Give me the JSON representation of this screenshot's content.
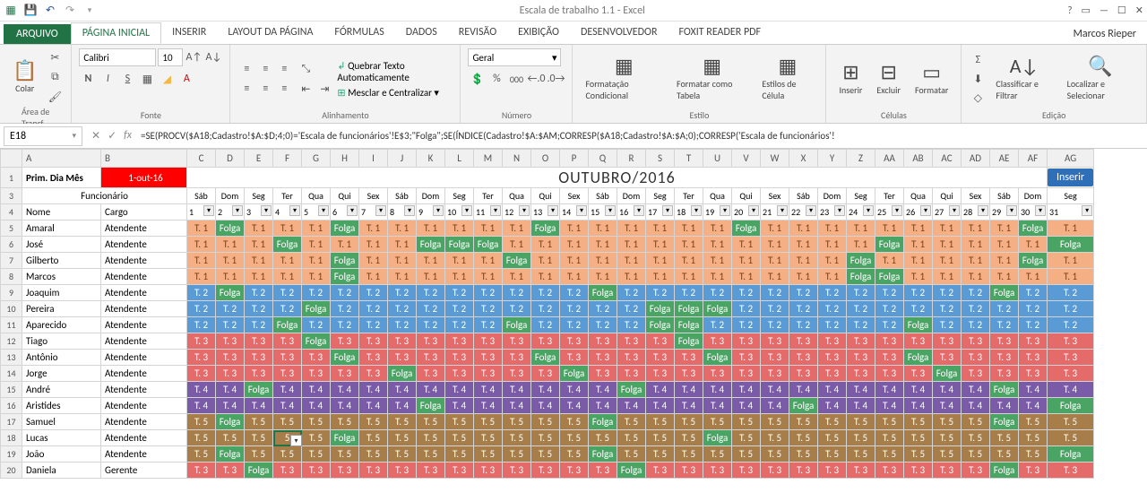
{
  "titlebar": {
    "title": "Escala de trabalho 1.1 - Excel"
  },
  "user": "Marcos Rieper",
  "tabs": {
    "file": "ARQUIVO",
    "items": [
      "PÁGINA INICIAL",
      "INSERIR",
      "LAYOUT DA PÁGINA",
      "FÓRMULAS",
      "DADOS",
      "REVISÃO",
      "EXIBIÇÃO",
      "DESENVOLVEDOR",
      "FOXIT READER PDF"
    ],
    "active": 0
  },
  "ribbon": {
    "clipboard": {
      "paste": "Colar",
      "label": "Área de Transf..."
    },
    "font": {
      "family": "Calibri",
      "size": "10",
      "label": "Fonte"
    },
    "align": {
      "wrap": "Quebrar Texto Automaticamente",
      "merge": "Mesclar e Centralizar",
      "label": "Alinhamento"
    },
    "number": {
      "format": "Geral",
      "label": "Número"
    },
    "styles": {
      "cond": "Formatação Condicional",
      "table": "Formatar como Tabela",
      "cell": "Estilos de Célula",
      "label": "Estilo"
    },
    "cells": {
      "insert": "Inserir",
      "delete": "Excluir",
      "format": "Formatar",
      "label": "Células"
    },
    "editing": {
      "sort": "Classificar e Filtrar",
      "find": "Localizar e Selecionar",
      "label": "Edição"
    }
  },
  "namebox": "E18",
  "formula": "=SE(PROCV($A18;Cadastro!$A:$D;4;0)='Escala de funcionários'!E$3;\"Folga\";SE(ÍNDICE(Cadastro!$A:$AM;CORRESP($A18;Cadastro!$A:$A;0);CORRESP('Escala de funcionários'!",
  "columns": [
    "",
    "A",
    "B",
    "C",
    "D",
    "E",
    "F",
    "G",
    "H",
    "I",
    "J",
    "K",
    "L",
    "M",
    "N",
    "O",
    "P",
    "Q",
    "R",
    "S",
    "T",
    "U",
    "V",
    "W",
    "X",
    "Y",
    "Z",
    "AA",
    "AB",
    "AC",
    "AD",
    "AE",
    "AF",
    "AG"
  ],
  "a1": "Prim. Dia Mês",
  "b1": "1-out-16",
  "month": "OUTUBRO/2016",
  "inserir": "Inserir",
  "funcHeader": "Funcionário",
  "nome": "Nome",
  "cargo": "Cargo",
  "dow": [
    "Sáb",
    "Dom",
    "Seg",
    "Ter",
    "Qua",
    "Qui",
    "Sex",
    "Sáb",
    "Dom",
    "Seg",
    "Ter",
    "Qua",
    "Qui",
    "Sex",
    "Sáb",
    "Dom",
    "Seg",
    "Ter",
    "Qua",
    "Qui",
    "Sex",
    "Sáb",
    "Dom",
    "Seg",
    "Ter",
    "Qua",
    "Qui",
    "Sex",
    "Sáb",
    "Dom",
    "Seg"
  ],
  "days": [
    "1",
    "2",
    "3",
    "4",
    "5",
    "6",
    "7",
    "8",
    "9",
    "10",
    "11",
    "12",
    "13",
    "14",
    "15",
    "16",
    "17",
    "18",
    "19",
    "20",
    "21",
    "22",
    "23",
    "24",
    "25",
    "26",
    "27",
    "28",
    "29",
    "30",
    "31"
  ],
  "rows": [
    {
      "n": "Amaral",
      "c": "Atendente",
      "s": [
        "T. 1",
        "Folga",
        "T. 1",
        "T. 1",
        "T. 1",
        "Folga",
        "T. 1",
        "T. 1",
        "T. 1",
        "T. 1",
        "T. 1",
        "T. 1",
        "Folga",
        "T. 1",
        "T. 1",
        "T. 1",
        "T. 1",
        "T. 1",
        "T. 1",
        "Folga",
        "T. 1",
        "T. 1",
        "T. 1",
        "T. 1",
        "T. 1",
        "T. 1",
        "T. 1",
        "T. 1",
        "T. 1",
        "Folga",
        "T. 1"
      ]
    },
    {
      "n": "José",
      "c": "Atendente",
      "s": [
        "T. 1",
        "T. 1",
        "T. 1",
        "Folga",
        "T. 1",
        "T. 1",
        "T. 1",
        "T. 1",
        "Folga",
        "Folga",
        "Folga",
        "T. 1",
        "T. 1",
        "T. 1",
        "T. 1",
        "T. 1",
        "T. 1",
        "T. 1",
        "T. 1",
        "T. 1",
        "T. 1",
        "T. 1",
        "T. 1",
        "T. 1",
        "Folga",
        "T. 1",
        "T. 1",
        "T. 1",
        "T. 1",
        "T. 1",
        "Folga"
      ]
    },
    {
      "n": "Gilberto",
      "c": "Atendente",
      "s": [
        "T. 1",
        "T. 1",
        "T. 1",
        "T. 1",
        "T. 1",
        "Folga",
        "T. 1",
        "T. 1",
        "T. 1",
        "T. 1",
        "T. 1",
        "Folga",
        "T. 1",
        "T. 1",
        "T. 1",
        "T. 1",
        "T. 1",
        "T. 1",
        "T. 1",
        "T. 1",
        "T. 1",
        "T. 1",
        "T. 1",
        "Folga",
        "T. 1",
        "T. 1",
        "T. 1",
        "T. 1",
        "T. 1",
        "Folga",
        "T. 1"
      ]
    },
    {
      "n": "Marcos",
      "c": "Atendente",
      "s": [
        "T. 1",
        "T. 1",
        "T. 1",
        "T. 1",
        "T. 1",
        "Folga",
        "T. 1",
        "T. 1",
        "T. 1",
        "T. 1",
        "T. 1",
        "T. 1",
        "T. 1",
        "T. 1",
        "T. 1",
        "T. 1",
        "T. 1",
        "T. 1",
        "T. 1",
        "T. 1",
        "T. 1",
        "T. 1",
        "T. 1",
        "Folga",
        "Folga",
        "T. 1",
        "T. 1",
        "T. 1",
        "T. 1",
        "T. 1",
        "T. 1"
      ]
    },
    {
      "n": "Joaquim",
      "c": "Atendente",
      "s": [
        "T. 2",
        "Folga",
        "T. 2",
        "T. 2",
        "T. 2",
        "T. 2",
        "T. 2",
        "T. 2",
        "T. 2",
        "T. 2",
        "T. 2",
        "T. 2",
        "T. 2",
        "T. 2",
        "Folga",
        "T. 2",
        "T. 2",
        "T. 2",
        "T. 2",
        "T. 2",
        "T. 2",
        "T. 2",
        "T. 2",
        "T. 2",
        "T. 2",
        "T. 2",
        "T. 2",
        "T. 2",
        "Folga",
        "T. 2",
        "T. 2"
      ]
    },
    {
      "n": "Pereira",
      "c": "Atendente",
      "s": [
        "T. 2",
        "T. 2",
        "T. 2",
        "T. 2",
        "Folga",
        "T. 2",
        "T. 2",
        "T. 2",
        "T. 2",
        "T. 2",
        "T. 2",
        "T. 2",
        "T. 2",
        "T. 2",
        "T. 2",
        "T. 2",
        "Folga",
        "Folga",
        "Folga",
        "T. 2",
        "T. 2",
        "T. 2",
        "T. 2",
        "T. 2",
        "T. 2",
        "T. 2",
        "T. 2",
        "T. 2",
        "T. 2",
        "T. 2",
        "T. 2"
      ]
    },
    {
      "n": "Aparecido",
      "c": "Atendente",
      "s": [
        "T. 2",
        "T. 2",
        "T. 2",
        "Folga",
        "T. 2",
        "T. 2",
        "T. 2",
        "T. 2",
        "T. 2",
        "T. 2",
        "T. 2",
        "Folga",
        "T. 2",
        "T. 2",
        "T. 2",
        "T. 2",
        "Folga",
        "Folga",
        "T. 2",
        "T. 2",
        "T. 2",
        "T. 2",
        "T. 2",
        "T. 2",
        "T. 2",
        "Folga",
        "T. 2",
        "T. 2",
        "T. 2",
        "T. 2",
        "T. 2"
      ]
    },
    {
      "n": "Tiago",
      "c": "Atendente",
      "s": [
        "T. 3",
        "T. 3",
        "T. 3",
        "T. 3",
        "Folga",
        "T. 3",
        "T. 3",
        "T. 3",
        "T. 3",
        "T. 3",
        "T. 3",
        "T. 3",
        "T. 3",
        "T. 3",
        "T. 3",
        "T. 3",
        "T. 3",
        "Folga",
        "T. 3",
        "T. 3",
        "T. 3",
        "T. 3",
        "T. 3",
        "T. 3",
        "T. 3",
        "T. 3",
        "T. 3",
        "T. 3",
        "T. 3",
        "T. 3",
        "T. 3"
      ]
    },
    {
      "n": "Antônio",
      "c": "Atendente",
      "s": [
        "T. 3",
        "T. 3",
        "T. 3",
        "T. 3",
        "T. 3",
        "Folga",
        "T. 3",
        "T. 3",
        "T. 3",
        "T. 3",
        "T. 3",
        "T. 3",
        "Folga",
        "T. 3",
        "T. 3",
        "T. 3",
        "T. 3",
        "T. 3",
        "Folga",
        "T. 3",
        "T. 3",
        "T. 3",
        "T. 3",
        "T. 3",
        "T. 3",
        "Folga",
        "T. 3",
        "T. 3",
        "T. 3",
        "T. 3",
        "T. 3"
      ]
    },
    {
      "n": "Jorge",
      "c": "Atendente",
      "s": [
        "T. 3",
        "T. 3",
        "T. 3",
        "T. 3",
        "T. 3",
        "T. 3",
        "T. 3",
        "Folga",
        "T. 3",
        "T. 3",
        "T. 3",
        "T. 3",
        "T. 3",
        "Folga",
        "T. 3",
        "T. 3",
        "T. 3",
        "T. 3",
        "T. 3",
        "T. 3",
        "T. 3",
        "T. 3",
        "T. 3",
        "T. 3",
        "T. 3",
        "T. 3",
        "Folga",
        "T. 3",
        "T. 3",
        "T. 3",
        "T. 3"
      ]
    },
    {
      "n": "André",
      "c": "Atendente",
      "s": [
        "T. 4",
        "T. 4",
        "Folga",
        "T. 4",
        "T. 4",
        "T. 4",
        "T. 4",
        "T. 4",
        "T. 4",
        "T. 4",
        "T. 4",
        "T. 4",
        "T. 4",
        "T. 4",
        "T. 4",
        "Folga",
        "T. 4",
        "T. 4",
        "T. 4",
        "T. 4",
        "T. 4",
        "T. 4",
        "T. 4",
        "T. 4",
        "T. 4",
        "T. 4",
        "T. 4",
        "T. 4",
        "Folga",
        "T. 4",
        "T. 4"
      ]
    },
    {
      "n": "Aristides",
      "c": "Atendente",
      "s": [
        "T. 4",
        "T. 4",
        "T. 4",
        "T. 4",
        "T. 4",
        "T. 4",
        "T. 4",
        "T. 4",
        "Folga",
        "T. 4",
        "T. 4",
        "T. 4",
        "T. 4",
        "T. 4",
        "T. 4",
        "T. 4",
        "T. 4",
        "T. 4",
        "T. 4",
        "T. 4",
        "T. 4",
        "Folga",
        "T. 4",
        "T. 4",
        "T. 4",
        "T. 4",
        "T. 4",
        "T. 4",
        "T. 4",
        "T. 4",
        "Folga"
      ]
    },
    {
      "n": "Samuel",
      "c": "Atendente",
      "s": [
        "T. 5",
        "Folga",
        "T. 5",
        "T. 5",
        "T. 5",
        "T. 5",
        "T. 5",
        "T. 5",
        "T. 5",
        "T. 5",
        "T. 5",
        "T. 5",
        "T. 5",
        "T. 5",
        "Folga",
        "T. 5",
        "T. 5",
        "T. 5",
        "T. 5",
        "T. 5",
        "T. 5",
        "T. 5",
        "T. 5",
        "T. 5",
        "T. 5",
        "T. 5",
        "T. 5",
        "T. 5",
        "Folga",
        "T. 5",
        "T. 5"
      ]
    },
    {
      "n": "Lucas",
      "c": "Atendente",
      "s": [
        "T. 5",
        "T. 5",
        "T. 5",
        "5",
        "T. 5",
        "Folga",
        "T. 5",
        "T. 5",
        "T. 5",
        "T. 5",
        "T. 5",
        "T. 5",
        "T. 5",
        "T. 5",
        "T. 5",
        "T. 5",
        "T. 5",
        "T. 5",
        "Folga",
        "T. 5",
        "T. 5",
        "T. 5",
        "T. 5",
        "T. 5",
        "T. 5",
        "T. 5",
        "T. 5",
        "T. 5",
        "T. 5",
        "T. 5",
        "T. 5"
      ]
    },
    {
      "n": "João",
      "c": "Atendente",
      "s": [
        "T. 5",
        "Folga",
        "T. 5",
        "T. 5",
        "T. 5",
        "T. 5",
        "T. 5",
        "T. 5",
        "T. 5",
        "T. 5",
        "T. 5",
        "T. 5",
        "T. 5",
        "T. 5",
        "Folga",
        "T. 5",
        "T. 5",
        "T. 5",
        "T. 5",
        "T. 5",
        "T. 5",
        "T. 5",
        "T. 5",
        "T. 5",
        "T. 5",
        "T. 5",
        "T. 5",
        "T. 5",
        "T. 5",
        "T. 5",
        "Folga"
      ]
    },
    {
      "n": "Daniela",
      "c": "Gerente",
      "s": [
        "T. 3",
        "T. 3",
        "Folga",
        "T. 3",
        "T. 3",
        "T. 3",
        "T. 3",
        "T. 3",
        "T. 3",
        "T. 3",
        "T. 3",
        "T. 3",
        "T. 3",
        "T. 3",
        "T. 3",
        "Folga",
        "T. 3",
        "T. 3",
        "T. 3",
        "T. 3",
        "T. 3",
        "T. 3",
        "T. 3",
        "T. 3",
        "T. 3",
        "T. 3",
        "T. 3",
        "T. 3",
        "Folga",
        "T. 3",
        "T. 3"
      ]
    }
  ],
  "selected": {
    "row": 13,
    "col": 3
  }
}
